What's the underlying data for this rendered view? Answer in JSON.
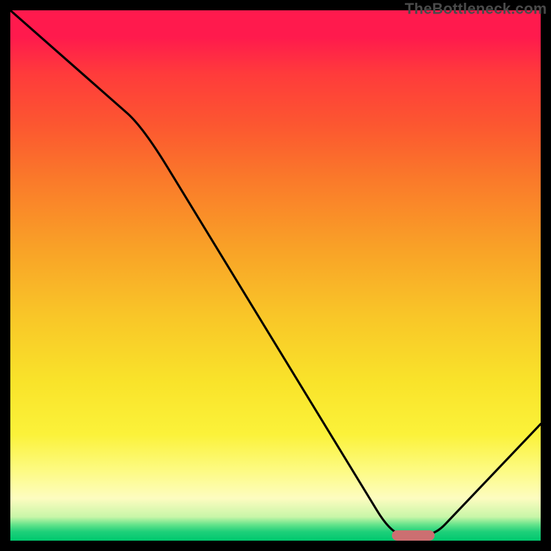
{
  "attribution": "TheBottleneck.com",
  "chart_data": {
    "type": "line",
    "title": "",
    "xlabel": "",
    "ylabel": "",
    "xlim": [
      0,
      100
    ],
    "ylim": [
      0,
      100
    ],
    "grid": false,
    "color_gradient": {
      "top": "#ff1a4d",
      "mid": "#f9c728",
      "bottom": "#00c86e"
    },
    "series": [
      {
        "name": "bottleneck-curve",
        "x": [
          0,
          25,
          72,
          80,
          100
        ],
        "values": [
          100,
          78,
          1,
          1,
          22
        ]
      }
    ],
    "marker": {
      "x_start": 72,
      "x_end": 80,
      "y": 1,
      "color": "#cc6f71"
    }
  }
}
